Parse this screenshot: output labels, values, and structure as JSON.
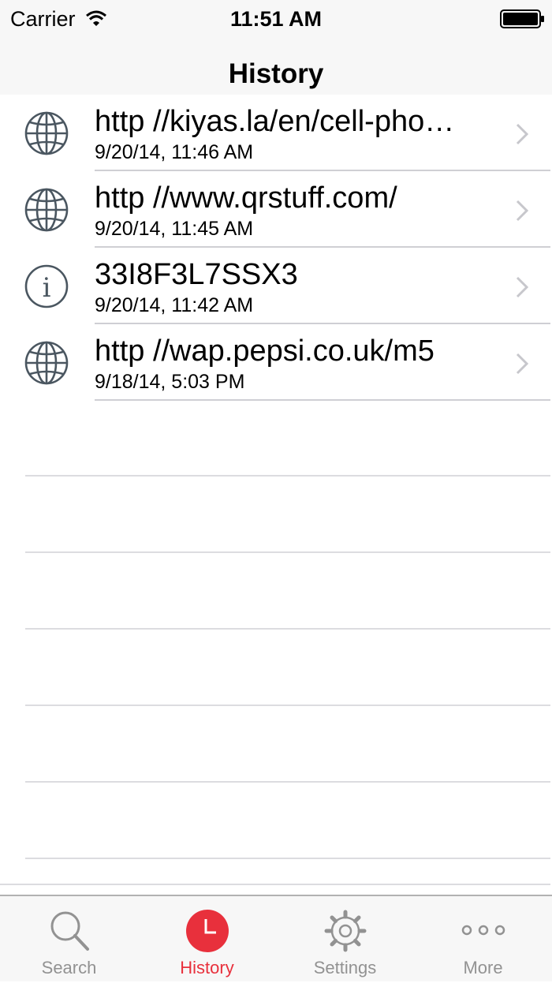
{
  "status_bar": {
    "carrier": "Carrier",
    "time": "11:51 AM"
  },
  "nav": {
    "title": "History"
  },
  "history": [
    {
      "icon": "globe-icon",
      "title": "http //kiyas.la/en/cell-pho…",
      "date": "9/20/14, 11:46 AM"
    },
    {
      "icon": "globe-icon",
      "title": "http //www.qrstuff.com/",
      "date": "9/20/14, 11:45 AM"
    },
    {
      "icon": "info-icon",
      "title": "33I8F3L7SSX3",
      "date": "9/20/14, 11:42 AM"
    },
    {
      "icon": "globe-icon",
      "title": "http //wap.pepsi.co.uk/m5",
      "date": "9/18/14, 5:03 PM"
    }
  ],
  "tabs": [
    {
      "label": "Search",
      "icon": "magnifier-icon",
      "active": false
    },
    {
      "label": "History",
      "icon": "clock-icon",
      "active": true
    },
    {
      "label": "Settings",
      "icon": "gear-icon",
      "active": false
    },
    {
      "label": "More",
      "icon": "more-dots-icon",
      "active": false
    }
  ],
  "colors": {
    "accent": "#e8303c",
    "inactive": "#929292",
    "icon": "#4a5660",
    "separator": "#cfcfd4"
  }
}
